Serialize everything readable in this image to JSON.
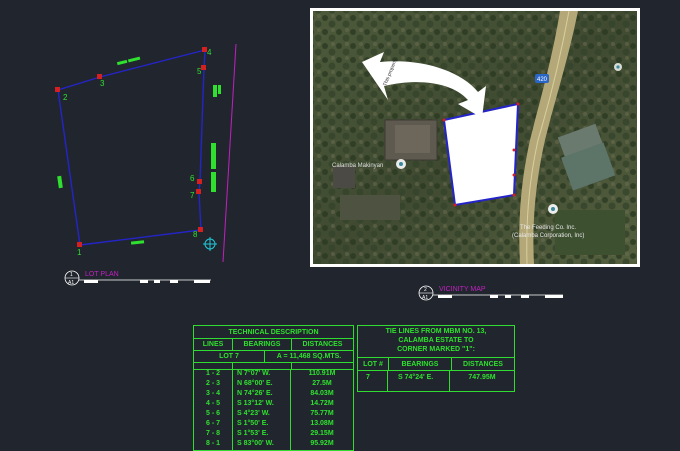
{
  "colors": {
    "background": "#21262e",
    "boundary": "#2424c8",
    "corner": "#d42020",
    "text_green": "#2fe02f",
    "magenta": "#c020c0"
  },
  "lot_plan": {
    "title": "LOT PLAN",
    "sheet_number": "1",
    "sheet_ref": "A1",
    "corners": [
      {
        "label": "1"
      },
      {
        "label": "2"
      },
      {
        "label": "3"
      },
      {
        "label": "4"
      },
      {
        "label": "5"
      },
      {
        "label": "6"
      },
      {
        "label": "7"
      },
      {
        "label": "8"
      }
    ]
  },
  "vicinity_map": {
    "title": "VICINITY MAP",
    "sheet_number": "2",
    "sheet_ref": "A1",
    "road_label": "420",
    "arrow_label": "This property",
    "place_labels": [
      "Calamba Makinyan",
      "The Feeding Co. Inc.",
      "(Calamba Corporation, Inc)"
    ],
    "pin_icon": "location-pin-icon"
  },
  "technical_description": {
    "title": "TECHNICAL DESCRIPTION",
    "headers": [
      "LINES",
      "BEARINGS",
      "DISTANCES"
    ],
    "lot_label": "LOT 7",
    "area_label": "A = 11,468 SQ.MTS.",
    "rows": [
      {
        "line": "1 - 2",
        "bearing": "N 7°07' W.",
        "distance": "110.91M"
      },
      {
        "line": "2 - 3",
        "bearing": "N 68°00' E.",
        "distance": "27.5M"
      },
      {
        "line": "3 - 4",
        "bearing": "N 74°26' E.",
        "distance": "84.03M"
      },
      {
        "line": "4 - 5",
        "bearing": "S 13°12' W.",
        "distance": "14.72M"
      },
      {
        "line": "5 - 6",
        "bearing": "S 4°23' W.",
        "distance": "75.77M"
      },
      {
        "line": "6 - 7",
        "bearing": "S 1°50' E.",
        "distance": "13.08M"
      },
      {
        "line": "7 - 8",
        "bearing": "S 1°53' E.",
        "distance": "29.15M"
      },
      {
        "line": "8 - 1",
        "bearing": "S 83°00' W.",
        "distance": "95.92M"
      }
    ]
  },
  "tie_lines": {
    "title_lines": [
      "TIE LINES FROM MBM NO. 13,",
      "CALAMBA ESTATE TO",
      "CORNER MARKED \"1\":"
    ],
    "headers": [
      "LOT #",
      "BEARINGS",
      "DISTANCES"
    ],
    "rows": [
      {
        "lot": "7",
        "bearing": "S 74°24' E.",
        "distance": "747.95M"
      }
    ]
  }
}
